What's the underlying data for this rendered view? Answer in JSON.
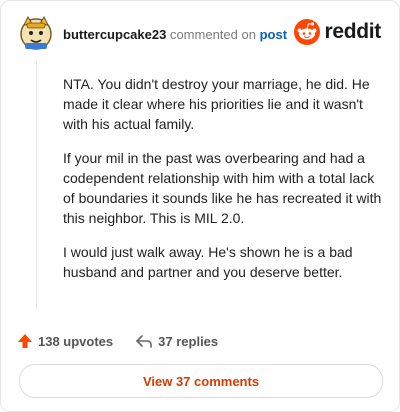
{
  "header": {
    "username": "buttercupcake23",
    "action_text": "commented on",
    "post_link": "post",
    "logo_text": "reddit"
  },
  "comment": {
    "paragraphs": [
      "NTA. You didn't destroy your marriage, he did. He made it clear where his priorities lie and it wasn't with his actual family.",
      "If your mil in the past was overbearing and had a codependent relationship with him with a total lack of boundaries it sounds like he has recreated it with this neighbor. This is MIL 2.0.",
      "I would just walk away. He's shown he is a bad husband and partner and you deserve better."
    ]
  },
  "actions": {
    "upvotes": "138 upvotes",
    "replies": "37 replies"
  },
  "footer": {
    "view_button": "View 37 comments"
  },
  "colors": {
    "reddit_orange": "#ff4500",
    "link_blue": "#0a5fbf",
    "button_text": "#d93a00"
  }
}
